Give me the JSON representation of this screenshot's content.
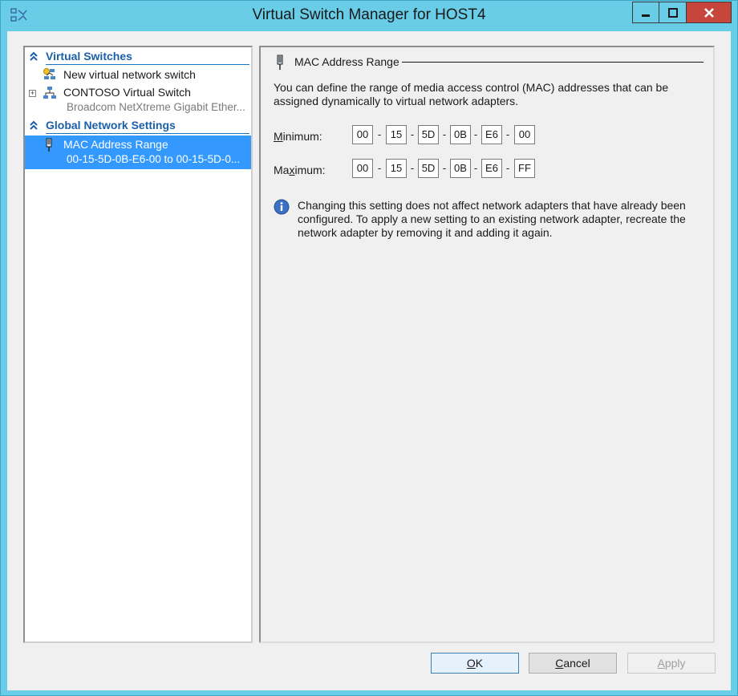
{
  "window": {
    "title": "Virtual Switch Manager for HOST4",
    "close_color": "#c7463b",
    "frame_color": "#69cde8"
  },
  "left_pane": {
    "sections": [
      {
        "label": "Virtual Switches"
      },
      {
        "label": "Global Network Settings"
      }
    ],
    "items": [
      {
        "label": "New virtual network switch",
        "icon": "new-switch-icon"
      },
      {
        "label": "CONTOSO Virtual Switch",
        "sub": "Broadcom NetXtreme Gigabit Ether...",
        "icon": "network-switch-icon"
      },
      {
        "label": "MAC Address Range",
        "sub": "00-15-5D-0B-E6-00 to 00-15-5D-0...",
        "icon": "network-adapter-icon",
        "selected": true
      }
    ]
  },
  "right_pane": {
    "title": "MAC Address Range",
    "description": "You can define the range of media access control (MAC) addresses that can be assigned dynamically to virtual network adapters.",
    "minimum": {
      "label_prefix": "",
      "label_accel": "M",
      "label_rest": "inimum:",
      "octets": [
        "00",
        "15",
        "5D",
        "0B",
        "E6",
        "00"
      ]
    },
    "maximum": {
      "label_prefix": "Ma",
      "label_accel": "x",
      "label_rest": "imum:",
      "octets": [
        "00",
        "15",
        "5D",
        "0B",
        "E6",
        "FF"
      ]
    },
    "separator": "-",
    "info": "Changing this setting does not affect network adapters that have already been configured.  To apply a new setting to an existing network adapter, recreate the network adapter by removing it and adding it again."
  },
  "buttons": {
    "ok_accel": "O",
    "ok_rest": "K",
    "cancel_accel": "C",
    "cancel_rest": "ancel",
    "apply_accel": "A",
    "apply_rest": "pply"
  }
}
